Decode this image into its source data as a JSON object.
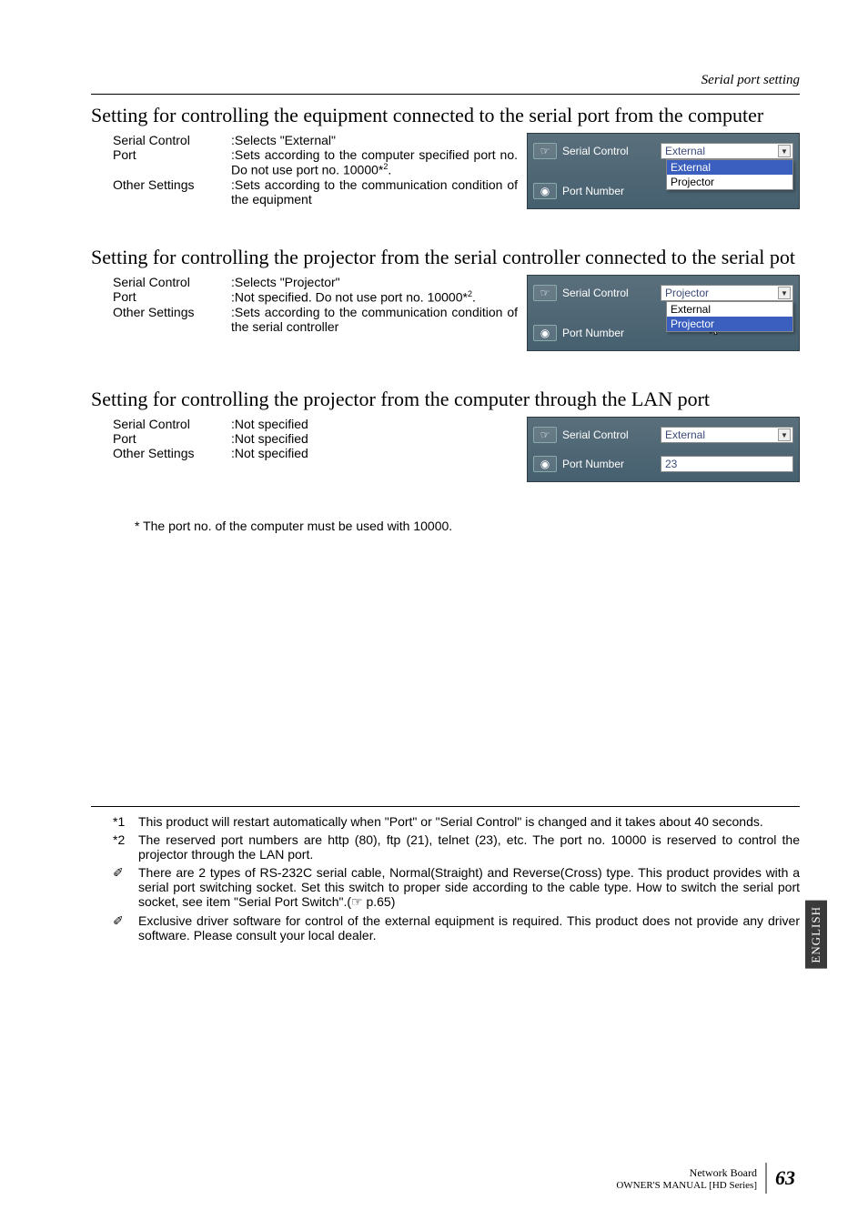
{
  "header_right": "Serial port setting",
  "section1": {
    "title": "Setting for controlling the equipment connected to the serial port from the computer",
    "rows": [
      {
        "label": "Serial Control",
        "val": ":Selects \"External\""
      },
      {
        "label": "Port",
        "val": ":Sets according to the computer specified port no. Do not use port no. 10000*",
        "sup": "2",
        "tail": "."
      },
      {
        "label": "Other Settings",
        "val": ":Sets according to the communication condition of the equipment"
      }
    ],
    "ui": {
      "serial_label": "Serial Control",
      "serial_value": "External",
      "port_label": "Port Number",
      "dropdown": [
        "External",
        "Projector"
      ],
      "dropdown_selected_index": 0
    }
  },
  "section2": {
    "title": "Setting for controlling the projector from the serial controller connected to the serial pot",
    "rows": [
      {
        "label": "Serial Control",
        "val": ":Selects \"Projector\""
      },
      {
        "label": "Port",
        "val": ":Not specified. Do not use port no. 10000*",
        "sup": "2",
        "tail": "."
      },
      {
        "label": "Other Settings",
        "val": ":Sets according to the communication condition of the serial controller"
      }
    ],
    "ui": {
      "serial_label": "Serial Control",
      "serial_value": "Projector",
      "port_label": "Port Number",
      "dropdown": [
        "External",
        "Projector"
      ],
      "dropdown_selected_index": 1
    }
  },
  "section3": {
    "title": "Setting for controlling the projector from the computer through the LAN port",
    "rows": [
      {
        "label": "Serial Control",
        "val": ":Not specified"
      },
      {
        "label": "Port",
        "val": ":Not specified"
      },
      {
        "label": "Other Settings",
        "val": ":Not specified"
      }
    ],
    "ui": {
      "serial_label": "Serial Control",
      "serial_value": "External",
      "port_label": "Port Number",
      "port_value": "23"
    }
  },
  "footnote_single": "* The port no. of the computer must be used with 10000.",
  "footnotes": [
    {
      "marker": "*1",
      "text": "This product will restart automatically when \"Port\" or \"Serial Control\" is changed and it takes about 40 seconds."
    },
    {
      "marker": "*2",
      "text": "The reserved port numbers are http (80), ftp (21), telnet (23), etc. The port no. 10000 is reserved to control the projector through the LAN port."
    },
    {
      "marker": "✐",
      "text": "There are 2 types of RS-232C serial cable, Normal(Straight) and Reverse(Cross) type. This product provides with a serial port switching socket. Set this switch to proper side according to the cable type. How to switch the serial port socket, see item \"Serial Port Switch\".(☞ p.65)"
    },
    {
      "marker": "✐",
      "text": "Exclusive driver software for control of the external equipment is required. This product does not provide any driver software. Please consult your local dealer."
    }
  ],
  "side_tab": "ENGLISH",
  "footer": {
    "line1": "Network Board",
    "line2": "OWNER'S MANUAL [HD Series]",
    "page": "63"
  }
}
